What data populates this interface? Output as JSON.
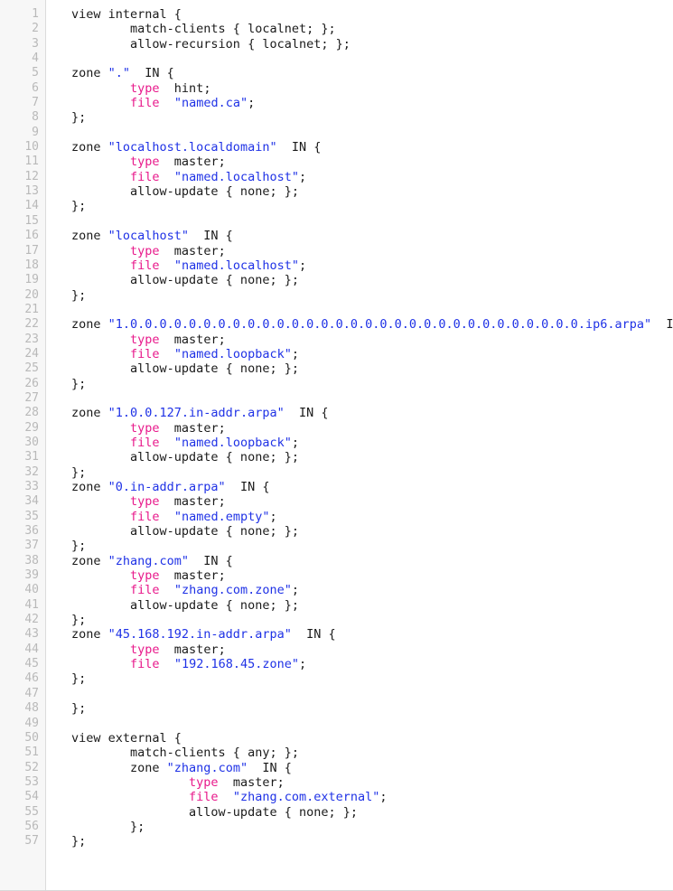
{
  "document": {
    "kind": "code-listing",
    "language": "bind-named-conf",
    "total_lines": 57,
    "first_line_number": 1,
    "last_line_number": 57,
    "colors": {
      "background": "#ffffff",
      "gutter_background": "#f7f7f7",
      "gutter_border": "#dcdcdc",
      "line_number_text": "#b9b9b9",
      "plain_text": "#1a1a1a",
      "keyword": "#e8198b",
      "string": "#1f32e6",
      "bottom_border": "#d8d8d8"
    }
  },
  "line_numbers": [
    "1",
    "2",
    "3",
    "4",
    "5",
    "6",
    "7",
    "8",
    "9",
    "10",
    "11",
    "12",
    "13",
    "14",
    "15",
    "16",
    "17",
    "18",
    "19",
    "20",
    "21",
    "22",
    "23",
    "24",
    "25",
    "26",
    "27",
    "28",
    "29",
    "30",
    "31",
    "32",
    "33",
    "34",
    "35",
    "36",
    "37",
    "38",
    "39",
    "40",
    "41",
    "42",
    "43",
    "44",
    "45",
    "46",
    "47",
    "48",
    "49",
    "50",
    "51",
    "52",
    "53",
    "54",
    "55",
    "56",
    "57"
  ],
  "lines": [
    {
      "n": 1,
      "tokens": [
        {
          "t": "plain",
          "v": "view internal {"
        }
      ]
    },
    {
      "n": 2,
      "tokens": [
        {
          "t": "plain",
          "v": "        match-clients { localnet; };"
        }
      ]
    },
    {
      "n": 3,
      "tokens": [
        {
          "t": "plain",
          "v": "        allow-recursion { localnet; };"
        }
      ]
    },
    {
      "n": 4,
      "tokens": [
        {
          "t": "plain",
          "v": ""
        }
      ]
    },
    {
      "n": 5,
      "tokens": [
        {
          "t": "plain",
          "v": "zone "
        },
        {
          "t": "string",
          "v": "\".\""
        },
        {
          "t": "plain",
          "v": "  IN {"
        }
      ]
    },
    {
      "n": 6,
      "tokens": [
        {
          "t": "plain",
          "v": "        "
        },
        {
          "t": "keyword",
          "v": "type"
        },
        {
          "t": "plain",
          "v": "  hint;"
        }
      ]
    },
    {
      "n": 7,
      "tokens": [
        {
          "t": "plain",
          "v": "        "
        },
        {
          "t": "keyword",
          "v": "file"
        },
        {
          "t": "plain",
          "v": "  "
        },
        {
          "t": "string",
          "v": "\"named.ca\""
        },
        {
          "t": "plain",
          "v": ";"
        }
      ]
    },
    {
      "n": 8,
      "tokens": [
        {
          "t": "plain",
          "v": "};"
        }
      ]
    },
    {
      "n": 9,
      "tokens": [
        {
          "t": "plain",
          "v": ""
        }
      ]
    },
    {
      "n": 10,
      "tokens": [
        {
          "t": "plain",
          "v": "zone "
        },
        {
          "t": "string",
          "v": "\"localhost.localdomain\""
        },
        {
          "t": "plain",
          "v": "  IN {"
        }
      ]
    },
    {
      "n": 11,
      "tokens": [
        {
          "t": "plain",
          "v": "        "
        },
        {
          "t": "keyword",
          "v": "type"
        },
        {
          "t": "plain",
          "v": "  master;"
        }
      ]
    },
    {
      "n": 12,
      "tokens": [
        {
          "t": "plain",
          "v": "        "
        },
        {
          "t": "keyword",
          "v": "file"
        },
        {
          "t": "plain",
          "v": "  "
        },
        {
          "t": "string",
          "v": "\"named.localhost\""
        },
        {
          "t": "plain",
          "v": ";"
        }
      ]
    },
    {
      "n": 13,
      "tokens": [
        {
          "t": "plain",
          "v": "        allow-update { none; };"
        }
      ]
    },
    {
      "n": 14,
      "tokens": [
        {
          "t": "plain",
          "v": "};"
        }
      ]
    },
    {
      "n": 15,
      "tokens": [
        {
          "t": "plain",
          "v": ""
        }
      ]
    },
    {
      "n": 16,
      "tokens": [
        {
          "t": "plain",
          "v": "zone "
        },
        {
          "t": "string",
          "v": "\"localhost\""
        },
        {
          "t": "plain",
          "v": "  IN {"
        }
      ]
    },
    {
      "n": 17,
      "tokens": [
        {
          "t": "plain",
          "v": "        "
        },
        {
          "t": "keyword",
          "v": "type"
        },
        {
          "t": "plain",
          "v": "  master;"
        }
      ]
    },
    {
      "n": 18,
      "tokens": [
        {
          "t": "plain",
          "v": "        "
        },
        {
          "t": "keyword",
          "v": "file"
        },
        {
          "t": "plain",
          "v": "  "
        },
        {
          "t": "string",
          "v": "\"named.localhost\""
        },
        {
          "t": "plain",
          "v": ";"
        }
      ]
    },
    {
      "n": 19,
      "tokens": [
        {
          "t": "plain",
          "v": "        allow-update { none; };"
        }
      ]
    },
    {
      "n": 20,
      "tokens": [
        {
          "t": "plain",
          "v": "};"
        }
      ]
    },
    {
      "n": 21,
      "tokens": [
        {
          "t": "plain",
          "v": ""
        }
      ]
    },
    {
      "n": 22,
      "tokens": [
        {
          "t": "plain",
          "v": "zone "
        },
        {
          "t": "string",
          "v": "\"1.0.0.0.0.0.0.0.0.0.0.0.0.0.0.0.0.0.0.0.0.0.0.0.0.0.0.0.0.0.0.0.ip6.arpa\""
        },
        {
          "t": "plain",
          "v": "  IN {"
        }
      ]
    },
    {
      "n": 23,
      "tokens": [
        {
          "t": "plain",
          "v": "        "
        },
        {
          "t": "keyword",
          "v": "type"
        },
        {
          "t": "plain",
          "v": "  master;"
        }
      ]
    },
    {
      "n": 24,
      "tokens": [
        {
          "t": "plain",
          "v": "        "
        },
        {
          "t": "keyword",
          "v": "file"
        },
        {
          "t": "plain",
          "v": "  "
        },
        {
          "t": "string",
          "v": "\"named.loopback\""
        },
        {
          "t": "plain",
          "v": ";"
        }
      ]
    },
    {
      "n": 25,
      "tokens": [
        {
          "t": "plain",
          "v": "        allow-update { none; };"
        }
      ]
    },
    {
      "n": 26,
      "tokens": [
        {
          "t": "plain",
          "v": "};"
        }
      ]
    },
    {
      "n": 27,
      "tokens": [
        {
          "t": "plain",
          "v": ""
        }
      ]
    },
    {
      "n": 28,
      "tokens": [
        {
          "t": "plain",
          "v": "zone "
        },
        {
          "t": "string",
          "v": "\"1.0.0.127.in-addr.arpa\""
        },
        {
          "t": "plain",
          "v": "  IN {"
        }
      ]
    },
    {
      "n": 29,
      "tokens": [
        {
          "t": "plain",
          "v": "        "
        },
        {
          "t": "keyword",
          "v": "type"
        },
        {
          "t": "plain",
          "v": "  master;"
        }
      ]
    },
    {
      "n": 30,
      "tokens": [
        {
          "t": "plain",
          "v": "        "
        },
        {
          "t": "keyword",
          "v": "file"
        },
        {
          "t": "plain",
          "v": "  "
        },
        {
          "t": "string",
          "v": "\"named.loopback\""
        },
        {
          "t": "plain",
          "v": ";"
        }
      ]
    },
    {
      "n": 31,
      "tokens": [
        {
          "t": "plain",
          "v": "        allow-update { none; };"
        }
      ]
    },
    {
      "n": 32,
      "tokens": [
        {
          "t": "plain",
          "v": "};"
        }
      ]
    },
    {
      "n": 33,
      "tokens": [
        {
          "t": "plain",
          "v": "zone "
        },
        {
          "t": "string",
          "v": "\"0.in-addr.arpa\""
        },
        {
          "t": "plain",
          "v": "  IN {"
        }
      ]
    },
    {
      "n": 34,
      "tokens": [
        {
          "t": "plain",
          "v": "        "
        },
        {
          "t": "keyword",
          "v": "type"
        },
        {
          "t": "plain",
          "v": "  master;"
        }
      ]
    },
    {
      "n": 35,
      "tokens": [
        {
          "t": "plain",
          "v": "        "
        },
        {
          "t": "keyword",
          "v": "file"
        },
        {
          "t": "plain",
          "v": "  "
        },
        {
          "t": "string",
          "v": "\"named.empty\""
        },
        {
          "t": "plain",
          "v": ";"
        }
      ]
    },
    {
      "n": 36,
      "tokens": [
        {
          "t": "plain",
          "v": "        allow-update { none; };"
        }
      ]
    },
    {
      "n": 37,
      "tokens": [
        {
          "t": "plain",
          "v": "};"
        }
      ]
    },
    {
      "n": 38,
      "tokens": [
        {
          "t": "plain",
          "v": "zone "
        },
        {
          "t": "string",
          "v": "\"zhang.com\""
        },
        {
          "t": "plain",
          "v": "  IN {"
        }
      ]
    },
    {
      "n": 39,
      "tokens": [
        {
          "t": "plain",
          "v": "        "
        },
        {
          "t": "keyword",
          "v": "type"
        },
        {
          "t": "plain",
          "v": "  master;"
        }
      ]
    },
    {
      "n": 40,
      "tokens": [
        {
          "t": "plain",
          "v": "        "
        },
        {
          "t": "keyword",
          "v": "file"
        },
        {
          "t": "plain",
          "v": "  "
        },
        {
          "t": "string",
          "v": "\"zhang.com.zone\""
        },
        {
          "t": "plain",
          "v": ";"
        }
      ]
    },
    {
      "n": 41,
      "tokens": [
        {
          "t": "plain",
          "v": "        allow-update { none; };"
        }
      ]
    },
    {
      "n": 42,
      "tokens": [
        {
          "t": "plain",
          "v": "};"
        }
      ]
    },
    {
      "n": 43,
      "tokens": [
        {
          "t": "plain",
          "v": "zone "
        },
        {
          "t": "string",
          "v": "\"45.168.192.in-addr.arpa\""
        },
        {
          "t": "plain",
          "v": "  IN {"
        }
      ]
    },
    {
      "n": 44,
      "tokens": [
        {
          "t": "plain",
          "v": "        "
        },
        {
          "t": "keyword",
          "v": "type"
        },
        {
          "t": "plain",
          "v": "  master;"
        }
      ]
    },
    {
      "n": 45,
      "tokens": [
        {
          "t": "plain",
          "v": "        "
        },
        {
          "t": "keyword",
          "v": "file"
        },
        {
          "t": "plain",
          "v": "  "
        },
        {
          "t": "string",
          "v": "\"192.168.45.zone\""
        },
        {
          "t": "plain",
          "v": ";"
        }
      ]
    },
    {
      "n": 46,
      "tokens": [
        {
          "t": "plain",
          "v": "};"
        }
      ]
    },
    {
      "n": 47,
      "tokens": [
        {
          "t": "plain",
          "v": ""
        }
      ]
    },
    {
      "n": 48,
      "tokens": [
        {
          "t": "plain",
          "v": "};"
        }
      ]
    },
    {
      "n": 49,
      "tokens": [
        {
          "t": "plain",
          "v": ""
        }
      ]
    },
    {
      "n": 50,
      "tokens": [
        {
          "t": "plain",
          "v": "view external {"
        }
      ]
    },
    {
      "n": 51,
      "tokens": [
        {
          "t": "plain",
          "v": "        match-clients { any; };"
        }
      ]
    },
    {
      "n": 52,
      "tokens": [
        {
          "t": "plain",
          "v": "        zone "
        },
        {
          "t": "string",
          "v": "\"zhang.com\""
        },
        {
          "t": "plain",
          "v": "  IN {"
        }
      ]
    },
    {
      "n": 53,
      "tokens": [
        {
          "t": "plain",
          "v": "                "
        },
        {
          "t": "keyword",
          "v": "type"
        },
        {
          "t": "plain",
          "v": "  master;"
        }
      ]
    },
    {
      "n": 54,
      "tokens": [
        {
          "t": "plain",
          "v": "                "
        },
        {
          "t": "keyword",
          "v": "file"
        },
        {
          "t": "plain",
          "v": "  "
        },
        {
          "t": "string",
          "v": "\"zhang.com.external\""
        },
        {
          "t": "plain",
          "v": ";"
        }
      ]
    },
    {
      "n": 55,
      "tokens": [
        {
          "t": "plain",
          "v": "                allow-update { none; };"
        }
      ]
    },
    {
      "n": 56,
      "tokens": [
        {
          "t": "plain",
          "v": "        };"
        }
      ]
    },
    {
      "n": 57,
      "tokens": [
        {
          "t": "plain",
          "v": "};"
        }
      ]
    }
  ]
}
